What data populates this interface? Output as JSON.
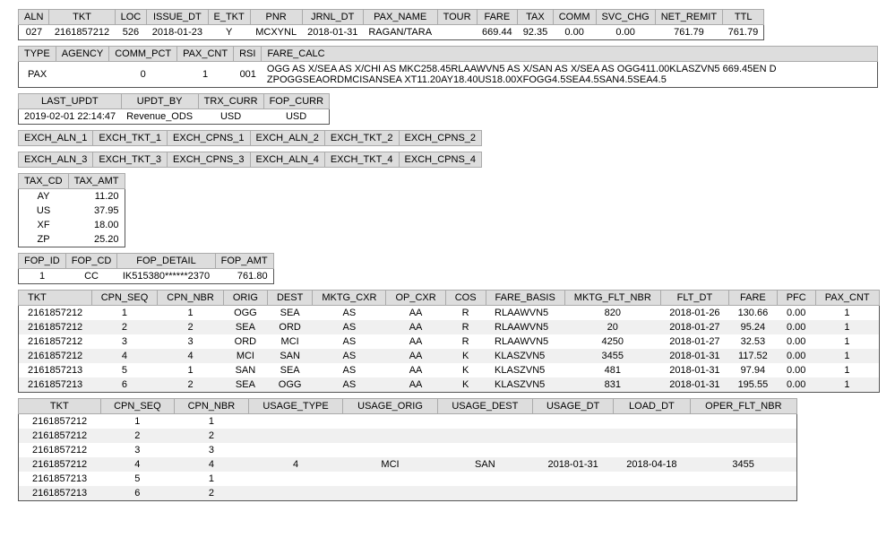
{
  "ticket_header": {
    "cols": [
      "ALN",
      "TKT",
      "LOC",
      "ISSUE_DT",
      "E_TKT",
      "PNR",
      "JRNL_DT",
      "PAX_NAME",
      "TOUR",
      "FARE",
      "TAX",
      "COMM",
      "SVC_CHG",
      "NET_REMIT",
      "TTL"
    ],
    "row": [
      "027",
      "2161857212",
      "526",
      "2018-01-23",
      "Y",
      "MCXYNL",
      "2018-01-31",
      "RAGAN/TARA",
      "",
      "669.44",
      "92.35",
      "0.00",
      "0.00",
      "761.79",
      "761.79"
    ]
  },
  "agency": {
    "cols": [
      "TYPE",
      "AGENCY",
      "COMM_PCT",
      "PAX_CNT",
      "RSI",
      "FARE_CALC"
    ],
    "row": [
      "PAX",
      "",
      "0",
      "1",
      "001",
      "OGG AS X/SEA AS X/CHI AS MKC258.45RLAAWVN5 AS X/SAN AS X/SEA AS OGG411.00KLASZVN5 669.45EN D ZPOGGSEAORDMCISANSEA XT11.20AY18.40US18.00XFOGG4.5SEA4.5SAN4.5SEA4.5"
    ]
  },
  "updt": {
    "cols": [
      "LAST_UPDT",
      "UPDT_BY",
      "TRX_CURR",
      "FOP_CURR"
    ],
    "row": [
      "2019-02-01 22:14:47",
      "Revenue_ODS",
      "USD",
      "USD"
    ]
  },
  "exch12": {
    "cols": [
      "EXCH_ALN_1",
      "EXCH_TKT_1",
      "EXCH_CPNS_1",
      "EXCH_ALN_2",
      "EXCH_TKT_2",
      "EXCH_CPNS_2"
    ]
  },
  "exch34": {
    "cols": [
      "EXCH_ALN_3",
      "EXCH_TKT_3",
      "EXCH_CPNS_3",
      "EXCH_ALN_4",
      "EXCH_TKT_4",
      "EXCH_CPNS_4"
    ]
  },
  "tax": {
    "cols": [
      "TAX_CD",
      "TAX_AMT"
    ],
    "rows": [
      [
        "AY",
        "11.20"
      ],
      [
        "US",
        "37.95"
      ],
      [
        "XF",
        "18.00"
      ],
      [
        "ZP",
        "25.20"
      ]
    ]
  },
  "fop": {
    "cols": [
      "FOP_ID",
      "FOP_CD",
      "FOP_DETAIL",
      "FOP_AMT"
    ],
    "row": [
      "1",
      "CC",
      "IK515380******2370",
      "761.80"
    ]
  },
  "coupons": {
    "cols": [
      "TKT",
      "CPN_SEQ",
      "CPN_NBR",
      "ORIG",
      "DEST",
      "MKTG_CXR",
      "OP_CXR",
      "COS",
      "FARE_BASIS",
      "MKTG_FLT_NBR",
      "FLT_DT",
      "FARE",
      "PFC",
      "PAX_CNT"
    ],
    "rows": [
      [
        "2161857212",
        "1",
        "1",
        "OGG",
        "SEA",
        "AS",
        "AA",
        "R",
        "RLAAWVN5",
        "820",
        "2018-01-26",
        "130.66",
        "0.00",
        "1"
      ],
      [
        "2161857212",
        "2",
        "2",
        "SEA",
        "ORD",
        "AS",
        "AA",
        "R",
        "RLAAWVN5",
        "20",
        "2018-01-27",
        "95.24",
        "0.00",
        "1"
      ],
      [
        "2161857212",
        "3",
        "3",
        "ORD",
        "MCI",
        "AS",
        "AA",
        "R",
        "RLAAWVN5",
        "4250",
        "2018-01-27",
        "32.53",
        "0.00",
        "1"
      ],
      [
        "2161857212",
        "4",
        "4",
        "MCI",
        "SAN",
        "AS",
        "AA",
        "K",
        "KLASZVN5",
        "3455",
        "2018-01-31",
        "117.52",
        "0.00",
        "1"
      ],
      [
        "2161857213",
        "5",
        "1",
        "SAN",
        "SEA",
        "AS",
        "AA",
        "K",
        "KLASZVN5",
        "481",
        "2018-01-31",
        "97.94",
        "0.00",
        "1"
      ],
      [
        "2161857213",
        "6",
        "2",
        "SEA",
        "OGG",
        "AS",
        "AA",
        "K",
        "KLASZVN5",
        "831",
        "2018-01-31",
        "195.55",
        "0.00",
        "1"
      ]
    ]
  },
  "usage": {
    "cols": [
      "TKT",
      "CPN_SEQ",
      "CPN_NBR",
      "USAGE_TYPE",
      "USAGE_ORIG",
      "USAGE_DEST",
      "USAGE_DT",
      "LOAD_DT",
      "OPER_FLT_NBR"
    ],
    "rows": [
      [
        "2161857212",
        "1",
        "1",
        "",
        "",
        "",
        "",
        "",
        ""
      ],
      [
        "2161857212",
        "2",
        "2",
        "",
        "",
        "",
        "",
        "",
        ""
      ],
      [
        "2161857212",
        "3",
        "3",
        "",
        "",
        "",
        "",
        "",
        ""
      ],
      [
        "2161857212",
        "4",
        "4",
        "4",
        "MCI",
        "SAN",
        "2018-01-31",
        "2018-04-18",
        "3455"
      ],
      [
        "2161857213",
        "5",
        "1",
        "",
        "",
        "",
        "",
        "",
        ""
      ],
      [
        "2161857213",
        "6",
        "2",
        "",
        "",
        "",
        "",
        "",
        ""
      ]
    ]
  }
}
